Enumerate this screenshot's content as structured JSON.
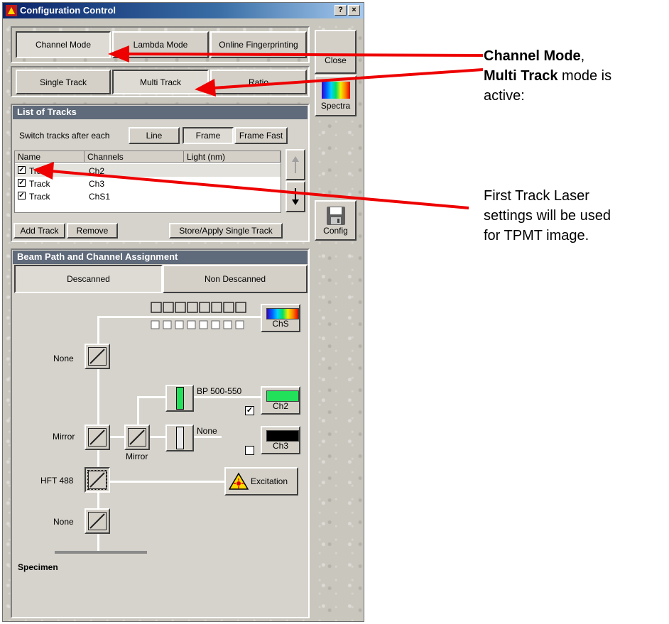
{
  "window": {
    "title": "Configuration Control",
    "help_btn": "?",
    "close_btn": "×"
  },
  "mode_tabs": [
    "Channel Mode",
    "Lambda Mode",
    "Online Fingerprinting"
  ],
  "track_tabs": [
    "Single Track",
    "Multi Track",
    "Ratio"
  ],
  "side_buttons": {
    "close": "Close",
    "spectra": "Spectra",
    "config": "Config"
  },
  "tracks": {
    "header": "List of Tracks",
    "switch_label": "Switch tracks after each",
    "switch_options": [
      "Line",
      "Frame",
      "Frame Fast"
    ],
    "columns": [
      "Name",
      "Channels",
      "Light (nm)"
    ],
    "rows": [
      {
        "name": "Track",
        "channels": "Ch2",
        "light": "",
        "checked": true
      },
      {
        "name": "Track",
        "channels": "Ch3",
        "light": "",
        "checked": true
      },
      {
        "name": "Track",
        "channels": "ChS1",
        "light": "",
        "checked": true
      }
    ],
    "actions": [
      "Add Track",
      "Remove",
      "Store/Apply Single Track"
    ]
  },
  "beam": {
    "header": "Beam Path and Channel Assignment",
    "tabs": [
      "Descanned",
      "Non Descanned"
    ],
    "labels": {
      "none_top": "None",
      "mirror_left": "Mirror",
      "mirror_mid": "Mirror",
      "hft": "HFT 488",
      "none_bottom": "None",
      "filter1": "BP 500-550",
      "filter2": "None",
      "specimen": "Specimen"
    },
    "detectors": {
      "chs": "ChS",
      "ch2": "Ch2",
      "ch3": "Ch3",
      "excitation": "Excitation"
    },
    "colors": {
      "ch2": "#22e05a",
      "ch3": "#000000"
    }
  },
  "annotations": {
    "a1_bold1": "Channel Mode",
    "a1_comma": ",",
    "a1_bold2": "Multi Track",
    "a1_rest": " mode is",
    "a1_line3": "active:",
    "a2_line1": "First Track Laser",
    "a2_line2": "settings will be used",
    "a2_line3": "for TPMT image."
  }
}
